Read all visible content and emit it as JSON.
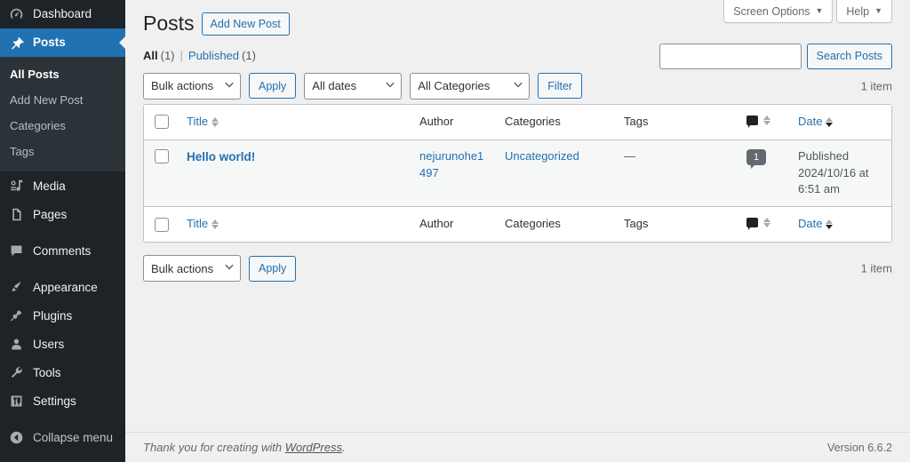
{
  "sidebar": {
    "items": [
      {
        "label": "Dashboard",
        "icon": "dashboard-icon",
        "name": "sidebar-item-dashboard",
        "active": false
      },
      {
        "label": "Posts",
        "icon": "pin-icon",
        "name": "sidebar-item-posts",
        "active": true
      },
      {
        "label": "Media",
        "icon": "media-icon",
        "name": "sidebar-item-media",
        "active": false
      },
      {
        "label": "Pages",
        "icon": "pages-icon",
        "name": "sidebar-item-pages",
        "active": false
      },
      {
        "label": "Comments",
        "icon": "comment-icon",
        "name": "sidebar-item-comments",
        "active": false
      },
      {
        "label": "Appearance",
        "icon": "brush-icon",
        "name": "sidebar-item-appearance",
        "active": false
      },
      {
        "label": "Plugins",
        "icon": "plug-icon",
        "name": "sidebar-item-plugins",
        "active": false
      },
      {
        "label": "Users",
        "icon": "user-icon",
        "name": "sidebar-item-users",
        "active": false
      },
      {
        "label": "Tools",
        "icon": "wrench-icon",
        "name": "sidebar-item-tools",
        "active": false
      },
      {
        "label": "Settings",
        "icon": "sliders-icon",
        "name": "sidebar-item-settings",
        "active": false
      }
    ],
    "submenu": [
      {
        "label": "All Posts",
        "current": true
      },
      {
        "label": "Add New Post",
        "current": false
      },
      {
        "label": "Categories",
        "current": false
      },
      {
        "label": "Tags",
        "current": false
      }
    ],
    "collapse": {
      "label": "Collapse menu",
      "icon": "collapse-left-icon"
    }
  },
  "screen_meta": {
    "screen_options_label": "Screen Options",
    "help_label": "Help",
    "caret": "▼"
  },
  "header": {
    "page_title": "Posts",
    "add_new_label": "Add New Post"
  },
  "views": {
    "all": {
      "label": "All",
      "count": "(1)"
    },
    "divider": "|",
    "published": {
      "label": "Published",
      "count": "(1)"
    }
  },
  "search": {
    "value": "",
    "placeholder": "",
    "button_label": "Search Posts"
  },
  "tablenav_top": {
    "bulk_actions": "Bulk actions",
    "apply_label": "Apply",
    "all_dates": "All dates",
    "all_categories": "All Categories",
    "filter_label": "Filter",
    "displaying_num": "1 item"
  },
  "tablenav_bottom": {
    "bulk_actions": "Bulk actions",
    "apply_label": "Apply",
    "displaying_num": "1 item"
  },
  "table": {
    "columns": {
      "title": "Title",
      "author": "Author",
      "categories": "Categories",
      "tags": "Tags",
      "comments_icon": "comment-icon",
      "date": "Date"
    },
    "rows": [
      {
        "title": "Hello world!",
        "author": "nejurunohe1497",
        "categories": "Uncategorized",
        "tags": "—",
        "comments": "1",
        "date_status": "Published",
        "date_value": "2024/10/16 at 6:51 am"
      }
    ]
  },
  "footer": {
    "thank_you_prefix": "Thank you for creating with ",
    "wordpress_link": "WordPress",
    "thank_you_suffix": ".",
    "version": "Version 6.6.2"
  },
  "colors": {
    "sidebar_bg": "#1d2327",
    "submenu_bg": "#2c3338",
    "accent_blue": "#2271b1",
    "page_bg": "#f0f0f1",
    "row_bg": "#f6f7f7",
    "bubble_gray": "#646970"
  }
}
